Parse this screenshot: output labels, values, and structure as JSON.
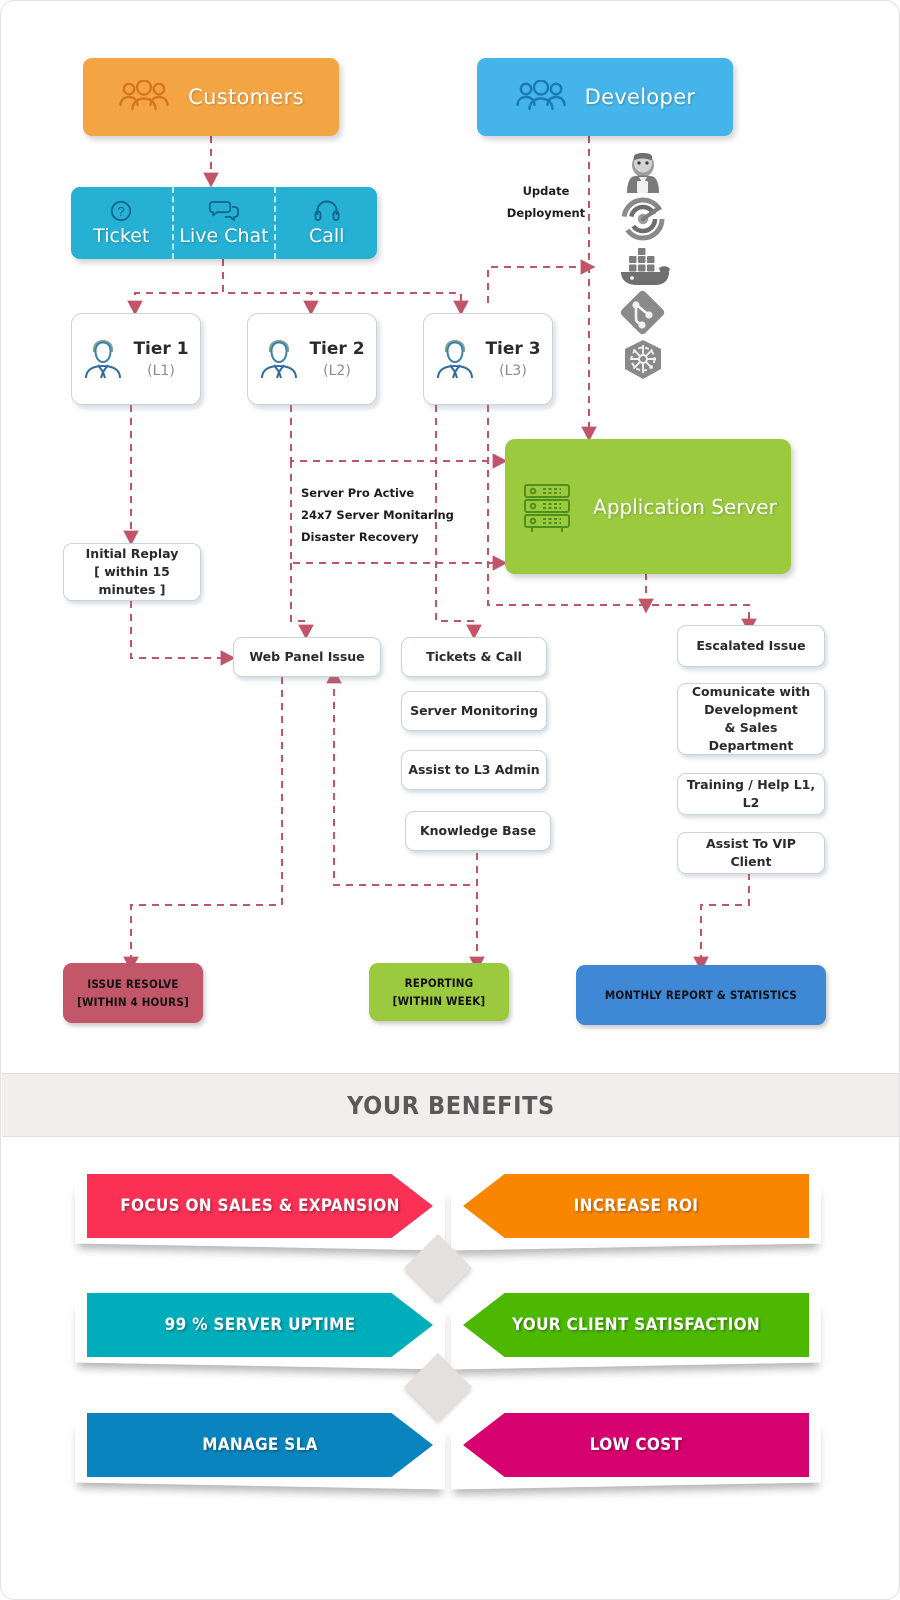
{
  "flow": {
    "customers": {
      "label": "Customers",
      "icon": "people-icon",
      "color": "#f4a543"
    },
    "developer": {
      "label": "Developer",
      "icon": "people-icon",
      "color": "#44b4ea"
    },
    "channels": [
      {
        "label": "Ticket",
        "icon": "question-circle-icon"
      },
      {
        "label": "Live Chat",
        "icon": "chat-bubbles-icon"
      },
      {
        "label": "Call",
        "icon": "headset-icon"
      }
    ],
    "channel_color": "#25b0d4",
    "devops_tools": [
      {
        "name": "jenkins-icon"
      },
      {
        "name": "ansible-icon"
      },
      {
        "name": "docker-icon"
      },
      {
        "name": "git-icon"
      },
      {
        "name": "kubernetes-icon"
      }
    ],
    "update_deployment_label": "Update\nDeployment",
    "tiers": [
      {
        "name": "Tier 1",
        "level": "(L1)",
        "icon": "agent-icon"
      },
      {
        "name": "Tier 2",
        "level": "(L2)",
        "icon": "agent-icon"
      },
      {
        "name": "Tier 3",
        "level": "(L3)",
        "icon": "agent-icon"
      }
    ],
    "app_server": {
      "label": "Application Server",
      "icon": "server-rack-icon",
      "color": "#9bca3e"
    },
    "server_notes": "Server Pro Active\n24x7 Server Monitaring\nDisaster Recovery",
    "initial_reply": "Initial Replay\n[ within 15 minutes ]",
    "web_panel_issue": "Web Panel Issue",
    "tier2_tasks": [
      "Tickets & Call",
      "Server Monitoring",
      "Assist to L3 Admin",
      "Knowledge Base"
    ],
    "tier3_tasks": [
      "Escalated Issue",
      "Comunicate with\nDevelopment\n& Sales Department",
      "Training / Help L1, L2",
      "Assist To VIP Client"
    ],
    "results": [
      {
        "label": "ISSUE RESOLVE\n[WITHIN 4 HOURS]",
        "color": "#c4566a"
      },
      {
        "label": "REPORTING\n[WITHIN WEEK]",
        "color": "#9bca3e"
      },
      {
        "label": "MONTHLY REPORT & STATISTICS",
        "color": "#3e88d6"
      }
    ],
    "connector_color": "#c2546a"
  },
  "benefits": {
    "title": "YOUR BENEFITS",
    "band_color": "#f2eeee",
    "items": [
      {
        "label": "FOCUS ON SALES &  EXPANSION",
        "color": "#fb3055",
        "side": "left",
        "row": 1
      },
      {
        "label": "INCREASE  ROI",
        "color": "#f98500",
        "side": "right",
        "row": 1
      },
      {
        "label": "99 % SERVER UPTIME",
        "color": "#00adbb",
        "side": "left",
        "row": 2
      },
      {
        "label": "YOUR CLIENT SATISFACTION",
        "color": "#4cb800",
        "side": "right",
        "row": 2
      },
      {
        "label": "MANAGE SLA",
        "color": "#0984be",
        "side": "left",
        "row": 3
      },
      {
        "label": "LOW COST",
        "color": "#d6006e",
        "side": "right",
        "row": 3
      }
    ],
    "diamond_color": "#e3e0de"
  }
}
